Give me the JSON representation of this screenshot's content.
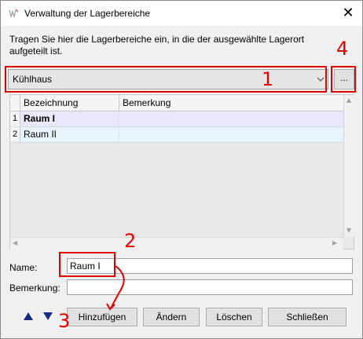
{
  "window": {
    "title": "Verwaltung der Lagerbereiche"
  },
  "instructions": "Tragen Sie hier die Lagerbereiche ein, in die der ausgewählte Lagerort aufgeteilt ist.",
  "storage_location": {
    "selected": "Kühlhaus"
  },
  "more_button_label": "...",
  "grid": {
    "columns": [
      "Bezeichnung",
      "Bemerkung"
    ],
    "rows": [
      {
        "num": "1",
        "bezeichnung": "Raum I",
        "bemerkung": ""
      },
      {
        "num": "2",
        "bezeichnung": "Raum II",
        "bemerkung": ""
      }
    ]
  },
  "form": {
    "name_label": "Name:",
    "name_value": "Raum I",
    "bemerkung_label": "Bemerkung:",
    "bemerkung_value": ""
  },
  "buttons": {
    "add": "Hinzufügen",
    "change": "Ändern",
    "delete": "Löschen",
    "close": "Schließen"
  },
  "annotations": [
    "1",
    "2",
    "3",
    "4"
  ],
  "colors": {
    "annotation": "#e00000",
    "selected_row": "#e8e8fa",
    "alt_row": "#e8f4fb",
    "arrow_button": "#1a2a80"
  }
}
